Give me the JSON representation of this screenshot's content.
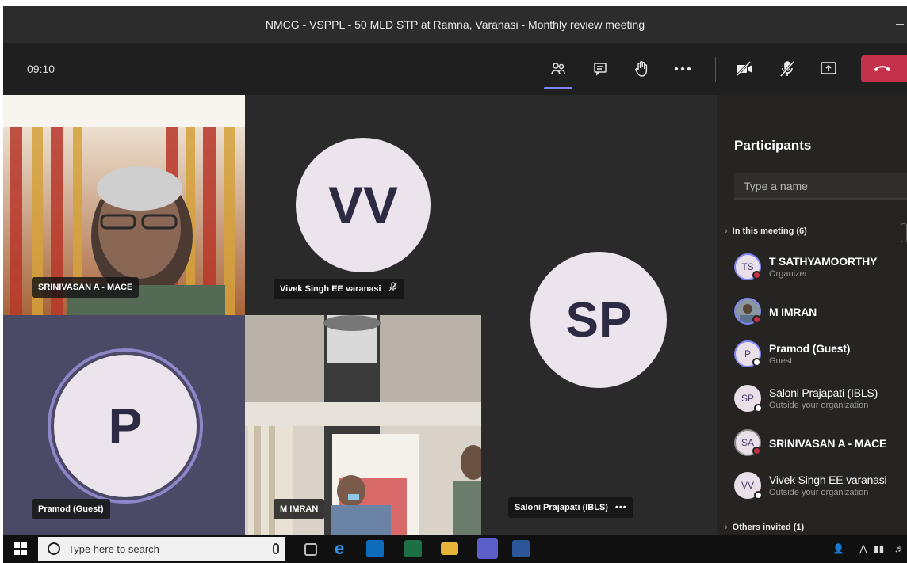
{
  "window": {
    "title": "NMCG - VSPPL - 50 MLD STP at Ramna, Varanasi - Monthly review meeting"
  },
  "controls": {
    "timer": "09:10",
    "items": [
      {
        "name": "participants-icon",
        "active": true
      },
      {
        "name": "chat-icon"
      },
      {
        "name": "raise-hand-icon"
      },
      {
        "name": "more-actions-icon"
      },
      {
        "name": "camera-off-icon"
      },
      {
        "name": "mic-off-icon"
      },
      {
        "name": "share-screen-icon"
      },
      {
        "name": "hang-up-icon"
      }
    ],
    "hangup_color": "#c4314b",
    "accent_color": "#7f85f5"
  },
  "tiles": {
    "srinivasan": {
      "name": "SRINIVASAN A - MACE"
    },
    "vivek": {
      "name": "Vivek Singh EE varanasi",
      "initials": "VV",
      "muted": true
    },
    "saloni": {
      "name": "Saloni Prajapati (IBLS)",
      "initials": "SP",
      "more": "•••"
    },
    "pramod": {
      "name": "Pramod (Guest)",
      "initials": "P",
      "speaking": true
    },
    "imran": {
      "name": "M IMRAN"
    }
  },
  "panel": {
    "title": "Participants",
    "search_placeholder": "Type a name",
    "in_meeting_label": "In this meeting (6)",
    "others_label": "Others invited (1)",
    "participants": [
      {
        "initials": "TS",
        "name": "T SATHYAMOORTHY",
        "role": "Organizer",
        "status": "busy"
      },
      {
        "initials": "",
        "name": "M IMRAN",
        "role": "",
        "status": "busy",
        "photo": true
      },
      {
        "initials": "P",
        "name": "Pramod (Guest)",
        "role": "Guest",
        "status": "available"
      },
      {
        "initials": "SP",
        "name": "Saloni Prajapati (IBLS)",
        "role": "Outside your organization",
        "status": "available"
      },
      {
        "initials": "SA",
        "name": "SRINIVASAN A - MACE",
        "role": "",
        "status": "busy"
      },
      {
        "initials": "VV",
        "name": "Vivek Singh EE varanasi",
        "role": "Outside your organization",
        "status": "available"
      }
    ],
    "status_colors": {
      "busy": "#c4314b",
      "available": "#8a8a8a"
    }
  },
  "taskbar": {
    "search_placeholder": "Type here to search",
    "apps": [
      "task-view-icon",
      "edge-icon",
      "outlook-icon",
      "excel-icon",
      "file-explorer-icon",
      "teams-icon",
      "word-icon"
    ],
    "tray_text": "⋀"
  }
}
